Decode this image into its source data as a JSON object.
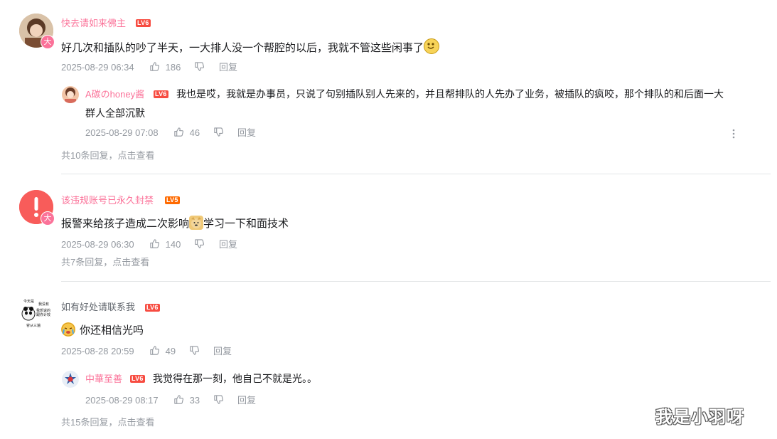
{
  "colors": {
    "pink_name": "#fb7299",
    "gray": "#9499a0",
    "divider": "#e3e5e7",
    "level_red": "#f74c41",
    "level_orange": "#ff6a00"
  },
  "comments": [
    {
      "username": "快去请如来佛主",
      "level": "LV6",
      "avatar_badge": "大",
      "text": "好几次和插队的吵了半天，一大排人没一个帮腔的以后，我就不管这些闲事了",
      "emoji": "grin-emoji",
      "date": "2025-08-29 06:34",
      "likes": "186",
      "reply_label": "回复",
      "replies": [
        {
          "username": "A碳のhoney酱",
          "level": "LV6",
          "text_line1": "我也是哎，我就是办事员，只说了句别插队别人先来的，并且帮排队的人先办了业务，被插队的疯咬，那个排队的和后面一大",
          "text_line2": "群人全部沉默",
          "date": "2025-08-29 07:08",
          "likes": "46",
          "reply_label": "回复"
        }
      ],
      "more_replies": "共10条回复，点击查看"
    },
    {
      "username": "该违规账号已永久封禁",
      "level": "LV5",
      "avatar_badge": "大",
      "text_before": "报警来给孩子造成二次影响",
      "text_after": "学习一下和面技术",
      "emoji": "doge-emoji",
      "date": "2025-08-29 06:30",
      "likes": "140",
      "reply_label": "回复",
      "more_replies": "共7条回复，点击查看"
    },
    {
      "username": "如有好处请联系我",
      "level": "LV6",
      "text": "你还相信光吗",
      "emoji": "cry-emoji",
      "date": "2025-08-28 20:59",
      "likes": "49",
      "reply_label": "回复",
      "replies": [
        {
          "username": "中華至善",
          "level": "LV6",
          "text": "我觉得在那一刻，他自己不就是光。。",
          "date": "2025-08-29 08:17",
          "likes": "33",
          "reply_label": "回复"
        }
      ],
      "more_replies": "共15条回复，点击查看"
    }
  ],
  "panda_meme_text": [
    "今天是",
    "我没有",
    "我想说的",
    "跟你计较",
    "容从三遍"
  ],
  "watermark": "我是小羽呀"
}
